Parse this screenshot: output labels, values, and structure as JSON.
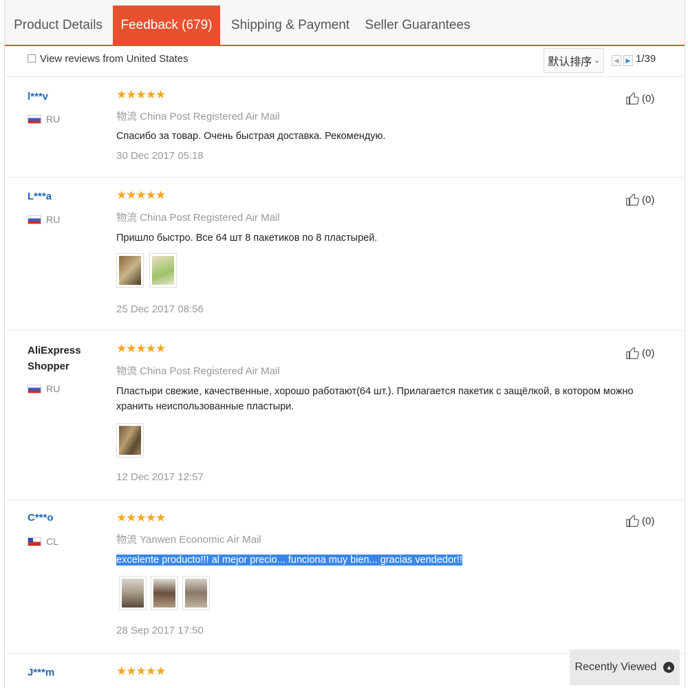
{
  "tabs": [
    {
      "label": "Product Details"
    },
    {
      "label": "Feedback (679)"
    },
    {
      "label": "Shipping & Payment"
    },
    {
      "label": "Seller Guarantees"
    }
  ],
  "toolbar": {
    "filter_label": "View reviews from United States",
    "sort_label": "默认排序",
    "page_indicator": "1/39"
  },
  "reviews": [
    {
      "name": "l***v",
      "country": "RU",
      "stars": "★★★★★",
      "shipping": "物流 China Post Registered Air Mail",
      "text": "Спасибо за товар. Очень быстрая доставка. Рекомендую.",
      "date": "30 Dec 2017 05:18",
      "likes": "(0)"
    },
    {
      "name": "L***a",
      "country": "RU",
      "stars": "★★★★★",
      "shipping": "物流 China Post Registered Air Mail",
      "text": "Пришло быстро. Все 64 шт 8 пакетиков по 8 пластырей.",
      "date": "25 Dec 2017 08:56",
      "likes": "(0)"
    },
    {
      "name": "AliExpress Shopper",
      "country": "RU",
      "stars": "★★★★★",
      "shipping": "物流 China Post Registered Air Mail",
      "text": "Пластыри свежие, качественные, хорошо работают(64 шт.). Прилагается пакетик с защёлкой, в котором можно хранить неиспользованные пластыри.",
      "date": "12 Dec 2017 12:57",
      "likes": "(0)"
    },
    {
      "name": "C***o",
      "country": "CL",
      "stars": "★★★★★",
      "shipping": "物流 Yanwen Economic Air Mail",
      "text": "excelente producto!!! al mejor precio... funciona muy bien... gracias vendedor!!",
      "date": "28 Sep 2017 17:50",
      "likes": "(0)"
    },
    {
      "name": "J***m",
      "stars": "★★★★★"
    }
  ],
  "recently_viewed": {
    "label": "Recently Viewed"
  },
  "colors": {
    "accent": "#e8502f",
    "link": "#2267b8",
    "star": "#f5a623",
    "highlight": "#3a86e8"
  }
}
